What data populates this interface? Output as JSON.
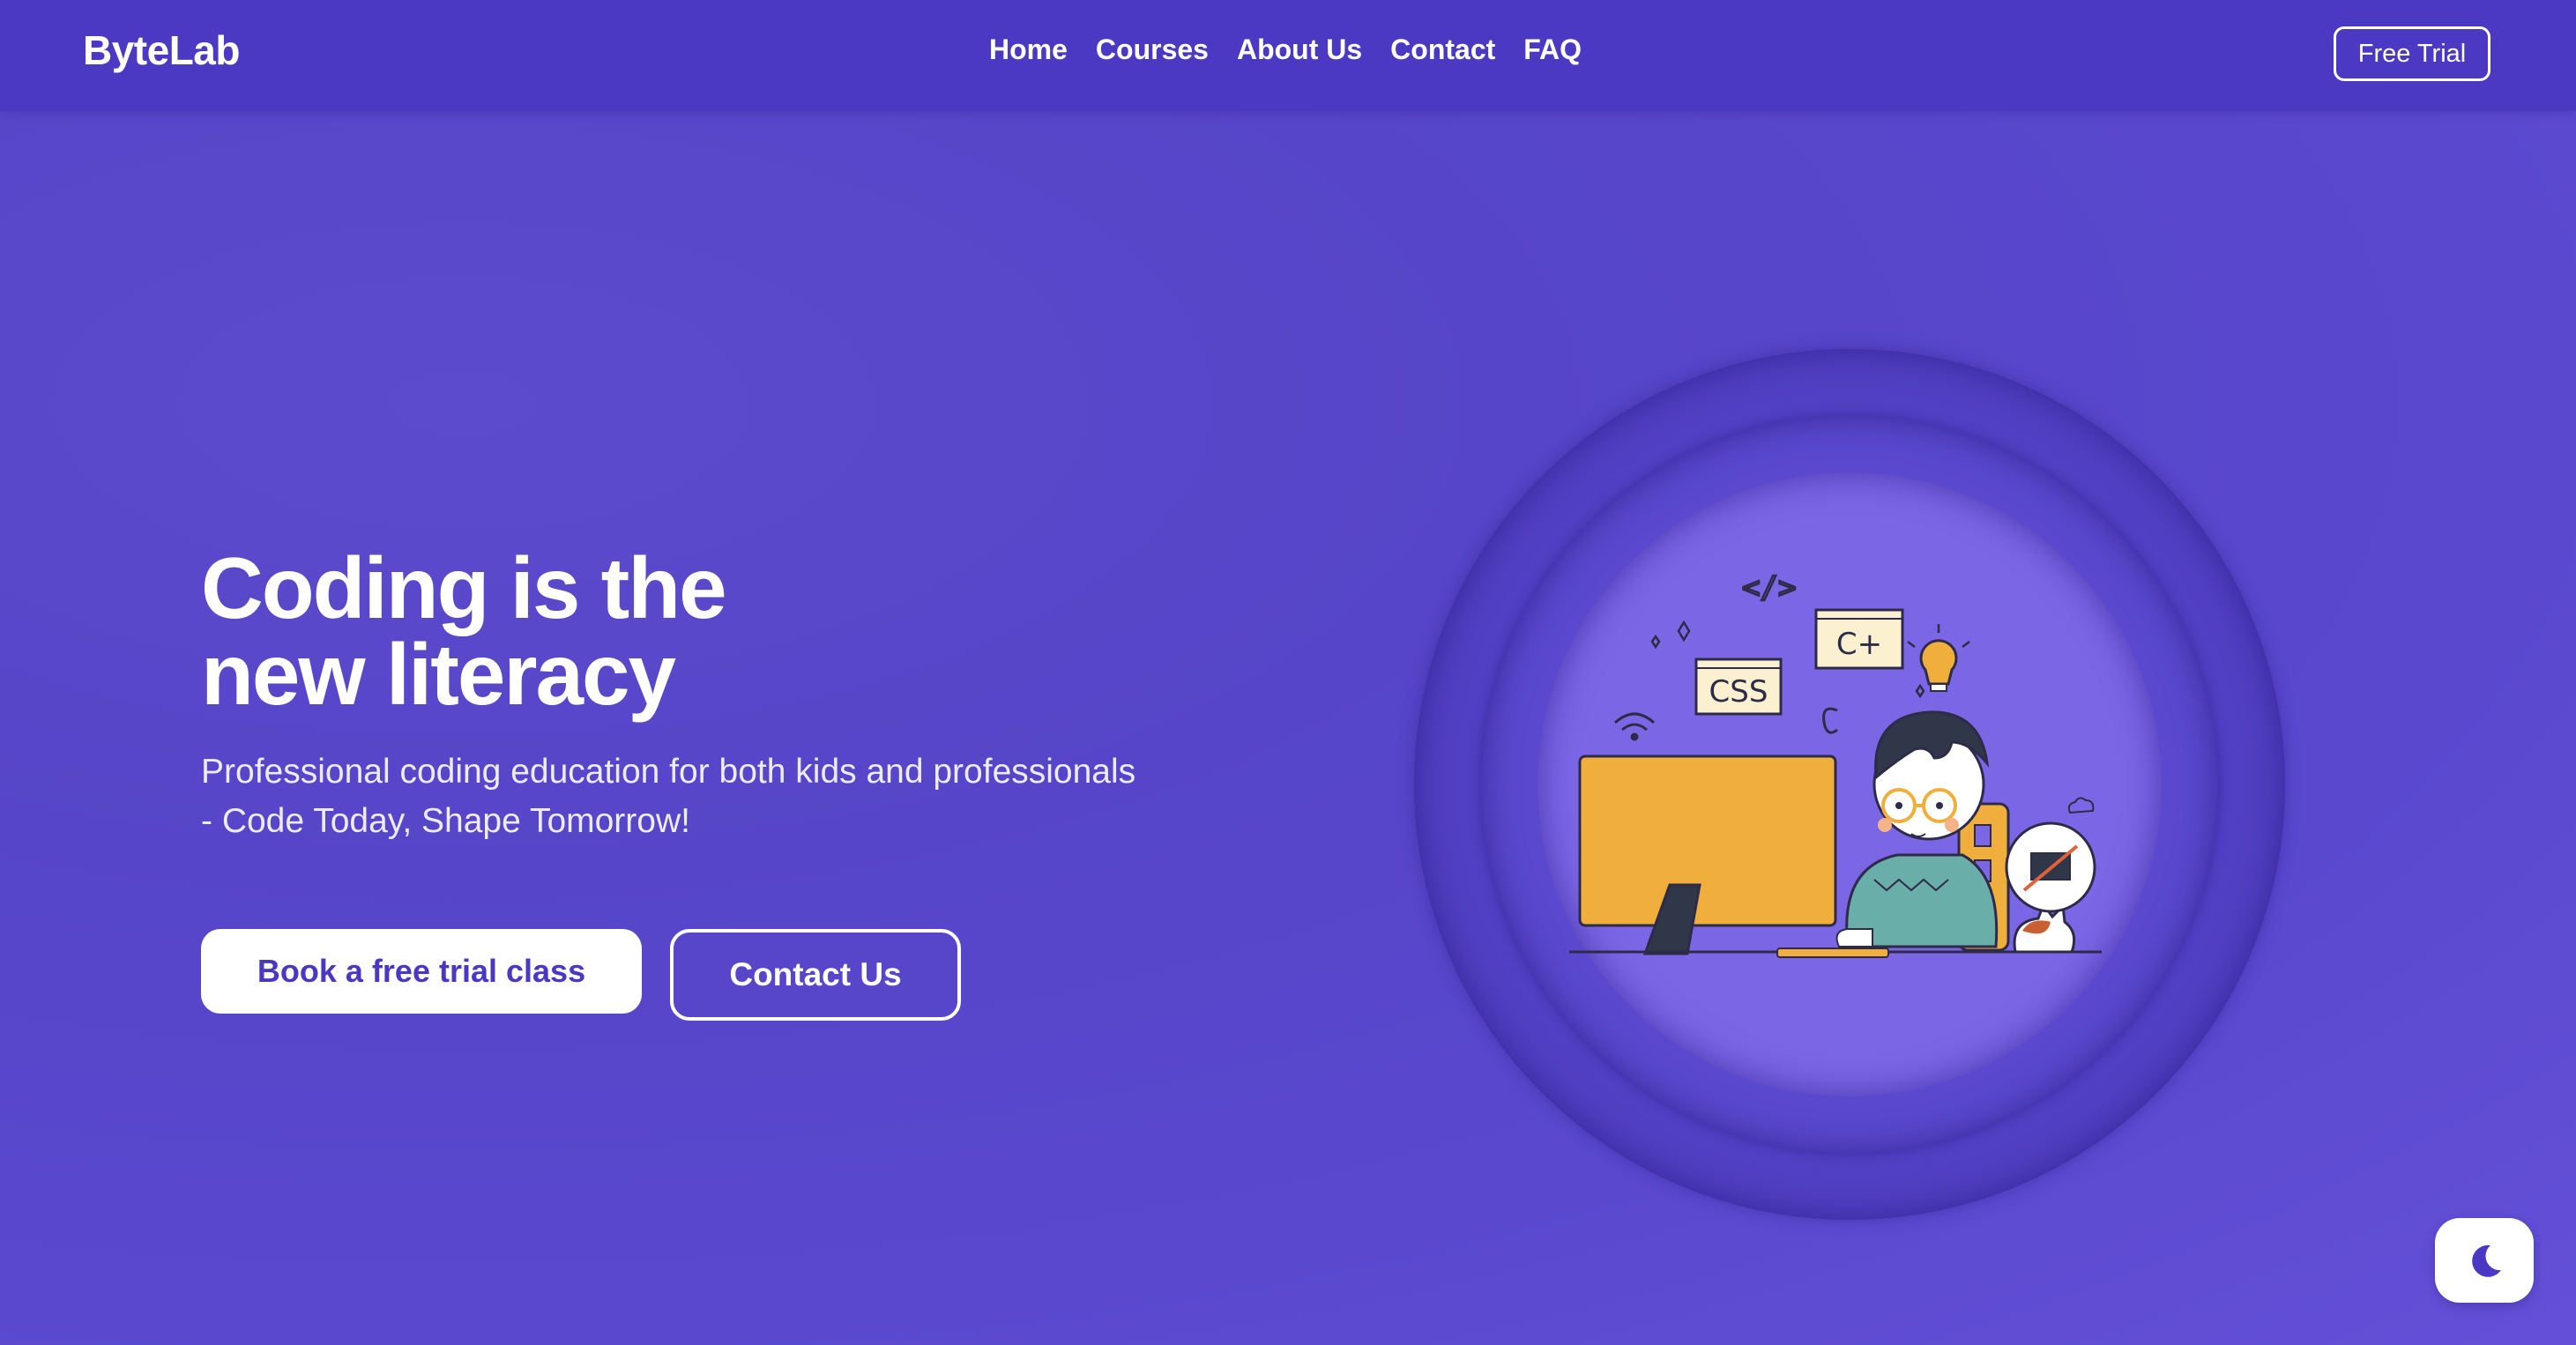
{
  "nav": {
    "brand": "ByteLab",
    "links": [
      "Home",
      "Courses",
      "About Us",
      "Contact",
      "FAQ"
    ],
    "cta_label": "Free Trial"
  },
  "hero": {
    "title_line1": "Coding is the",
    "title_line2": "new literacy",
    "subtitle_line1": "Professional coding education for both kids and professionals",
    "subtitle_line2": "- Code Today, Shape Tomorrow!",
    "primary_button": "Book a free trial class",
    "secondary_button": "Contact Us"
  },
  "illustration": {
    "tag_code": "</>",
    "tag_css": "CSS",
    "tag_cplus": "C+"
  },
  "icons": {
    "theme_toggle": "moon-icon"
  },
  "colors": {
    "background": "#5645c8",
    "navbar": "#4b38c3",
    "accent_orange": "#f0ae3c",
    "button_text": "#4a37c4"
  }
}
